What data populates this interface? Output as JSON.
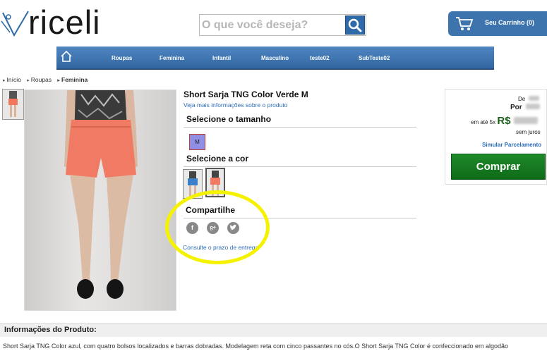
{
  "header": {
    "logo_text": "riceli",
    "search_placeholder": "O que você deseja?",
    "cart_label": "Seu Carrinho (0)"
  },
  "nav": {
    "items": [
      "Roupas",
      "Feminina",
      "Infantil",
      "Masculino",
      "teste02",
      "SubTeste02"
    ]
  },
  "breadcrumb": [
    "Início",
    "Roupas",
    "Feminina"
  ],
  "product": {
    "title": "Short Sarja TNG Color Verde M",
    "more_info_link": "Veja mais informações sobre o produto",
    "size_heading": "Selecione o tamanho",
    "size_option": "M",
    "color_heading": "Selecione a cor",
    "share_heading": "Compartilhe",
    "shipping_link": "Consulte o prazo de entrega"
  },
  "price": {
    "de_label": "De",
    "por_label": "Por",
    "installment_label": "em até 5x",
    "currency": "R$",
    "no_interest": "sem juros",
    "simulate_link": "Simular Parcelamento",
    "buy_label": "Comprar"
  },
  "info": {
    "heading": "Informações do Produto:",
    "description": "Short Sarja TNG Color azul, com quatro bolsos localizados e barras dobradas. Modelagem reta com cinco passantes no cós.O Short Sarja TNG Color é confeccionado em algodão"
  },
  "colors": {
    "nav_bg": "#3d74ae",
    "buy_bg": "#1a7a22",
    "highlight": "#f5f200",
    "link": "#2b6cb8"
  }
}
